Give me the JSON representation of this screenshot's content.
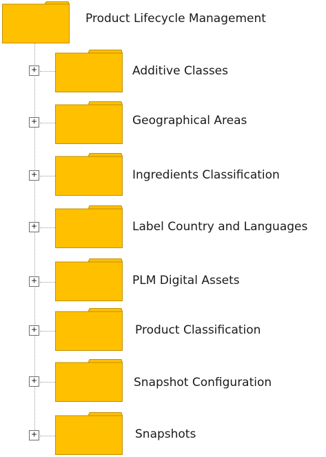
{
  "tree": {
    "root": {
      "label": "Product Lifecycle Management",
      "icon": "folder-icon"
    },
    "expander_glyph": "+",
    "children": [
      {
        "label": "Additive Classes",
        "icon": "folder-icon"
      },
      {
        "label": "Geographical Areas",
        "icon": "folder-icon"
      },
      {
        "label": "Ingredients Classification",
        "icon": "folder-icon"
      },
      {
        "label": "Label Country and Languages",
        "icon": "folder-icon"
      },
      {
        "label": "PLM Digital Assets",
        "icon": "folder-icon"
      },
      {
        "label": "Product Classification",
        "icon": "folder-icon"
      },
      {
        "label": "Snapshot Configuration",
        "icon": "folder-icon"
      },
      {
        "label": "Snapshots",
        "icon": "folder-icon"
      }
    ]
  },
  "colors": {
    "folder_fill": "#FFC000",
    "folder_stroke": "#BF9000",
    "tree_line": "#9A9A9A"
  }
}
